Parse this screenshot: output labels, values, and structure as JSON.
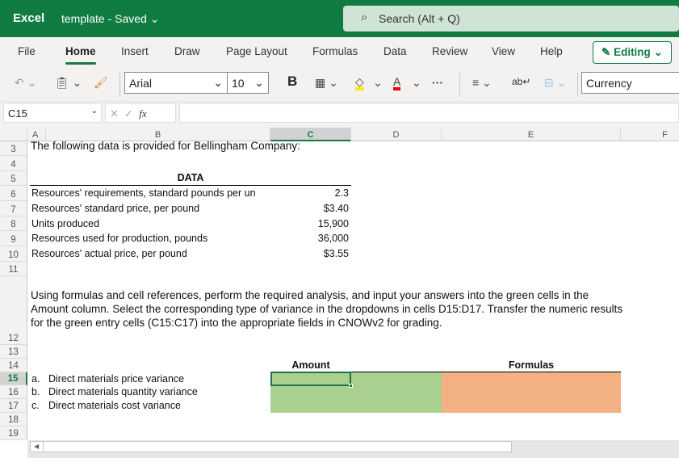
{
  "app": {
    "name": "Excel",
    "document": "template",
    "status": "Saved",
    "search": "Search (Alt + Q)"
  },
  "tabs": [
    "File",
    "Home",
    "Insert",
    "Draw",
    "Page Layout",
    "Formulas",
    "Data",
    "Review",
    "View",
    "Help"
  ],
  "editing": "Editing",
  "toolbar": {
    "font": "Arial",
    "size": "10",
    "bold": "B",
    "number_format": "Currency"
  },
  "formula_bar": {
    "name_box": "C15",
    "fx": "fx",
    "value": ""
  },
  "columns": [
    "A",
    "B",
    "C",
    "D",
    "E",
    "F"
  ],
  "rows": [
    "3",
    "4",
    "5",
    "6",
    "7",
    "8",
    "9",
    "10",
    "11",
    "12",
    "13",
    "14",
    "15",
    "16",
    "17",
    "18",
    "19"
  ],
  "sheet": {
    "intro": "The following data is provided for Bellingham Company:",
    "data_header": "DATA",
    "data": [
      {
        "label": "Resources' requirements, standard pounds per un",
        "value": "2.3"
      },
      {
        "label": "Resources' standard price, per pound",
        "value": "$3.40"
      },
      {
        "label": "Units produced",
        "value": "15,900"
      },
      {
        "label": "Resources used for production, pounds",
        "value": "36,000"
      },
      {
        "label": "Resources' actual price, per pound",
        "value": "$3.55"
      }
    ],
    "instructions": "Using formulas and cell references, perform the required analysis, and input your answers into the green cells in the Amount column. Select the corresponding type of variance in the dropdowns in cells D15:D17. Transfer the numeric results for the green entry cells (C15:C17) into the appropriate fields in CNOWv2 for grading.",
    "amount_header": "Amount",
    "formulas_header": "Formulas",
    "items": [
      {
        "letter": "a.",
        "label": "Direct materials price variance"
      },
      {
        "letter": "b.",
        "label": "Direct materials quantity variance"
      },
      {
        "letter": "c.",
        "label": "Direct materials cost variance"
      }
    ]
  },
  "colors": {
    "brand": "#107c41",
    "green_cell": "#a9d08e",
    "orange_cell": "#f4b183"
  }
}
